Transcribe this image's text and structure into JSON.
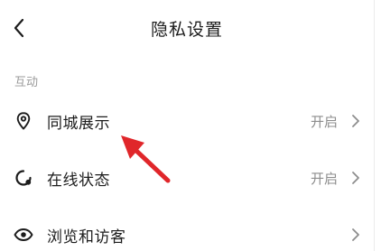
{
  "header": {
    "title": "隐私设置",
    "back_icon": "chevron-left-icon"
  },
  "section": {
    "label": "互动"
  },
  "rows": [
    {
      "label": "同城展示",
      "value": "开启",
      "icon": "location-pin-icon"
    },
    {
      "label": "在线状态",
      "value": "开启",
      "icon": "online-status-icon"
    },
    {
      "label": "浏览和访客",
      "value": "",
      "icon": "eye-icon"
    }
  ],
  "colors": {
    "annotation_arrow": "#e0262a",
    "secondary_text": "#8d8d8d",
    "section_label": "#9a9a9a"
  }
}
